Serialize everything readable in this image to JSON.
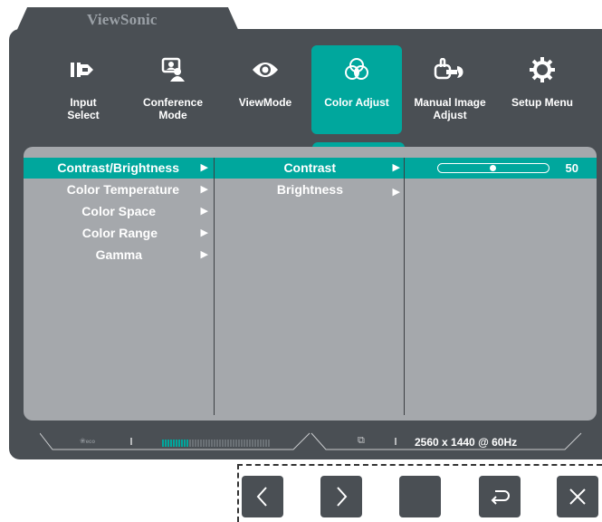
{
  "brand": "ViewSonic",
  "menu": [
    {
      "label_line1": "Input",
      "label_line2": "Select",
      "icon": "input-select-icon"
    },
    {
      "label_line1": "Conference",
      "label_line2": "Mode",
      "icon": "conference-mode-icon"
    },
    {
      "label_line1": "ViewMode",
      "label_line2": "",
      "icon": "eye-icon"
    },
    {
      "label_line1": "Color Adjust",
      "label_line2": "",
      "icon": "color-circles-icon",
      "active": true
    },
    {
      "label_line1": "Manual Image",
      "label_line2": "Adjust",
      "icon": "wrench-hand-icon"
    },
    {
      "label_line1": "Setup Menu",
      "label_line2": "",
      "icon": "gear-icon"
    }
  ],
  "column1": [
    {
      "label": "Contrast/Brightness",
      "selected": true
    },
    {
      "label": "Color Temperature"
    },
    {
      "label": "Color Space"
    },
    {
      "label": "Color Range"
    },
    {
      "label": "Gamma"
    }
  ],
  "column2": [
    {
      "label": "Contrast",
      "selected": true
    },
    {
      "label": "Brightness"
    }
  ],
  "slider": {
    "value": "50",
    "fraction": 0.5
  },
  "status": {
    "eco_text": "eco",
    "resolution": "2560 x 1440 @ 60Hz",
    "energy_level_fraction": 0.25
  },
  "buttons": [
    {
      "icon": "chevron-left-icon"
    },
    {
      "icon": "chevron-right-icon"
    },
    {
      "icon": "blank-icon"
    },
    {
      "icon": "return-icon"
    },
    {
      "icon": "close-icon"
    }
  ],
  "colors": {
    "panel": "#4a4f54",
    "accent": "#00a79d",
    "content": "#a5a8ac"
  }
}
